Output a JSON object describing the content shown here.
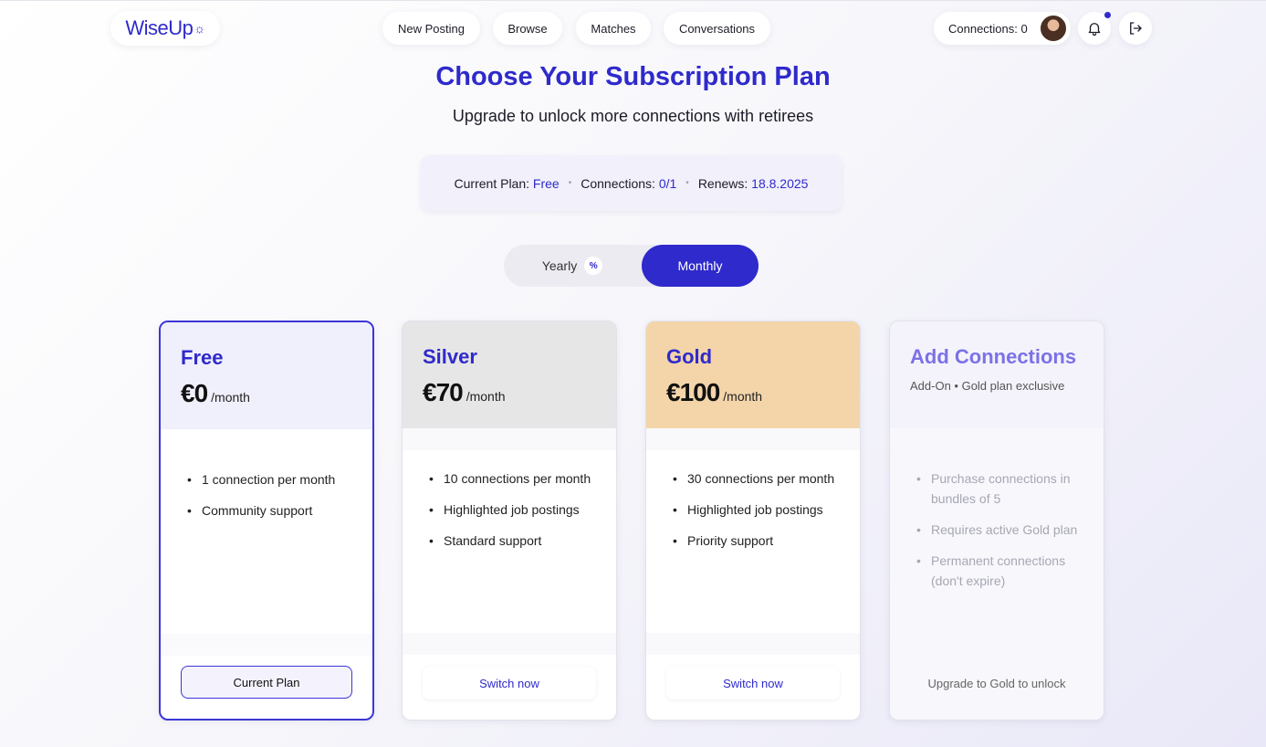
{
  "header": {
    "logo_text": "WiseUp",
    "nav": [
      "New Posting",
      "Browse",
      "Matches",
      "Conversations"
    ],
    "connections_label": "Connections: 0"
  },
  "page": {
    "title": "Choose Your Subscription Plan",
    "subtitle": "Upgrade to unlock more connections with retirees"
  },
  "status": {
    "plan_label": "Current Plan:",
    "plan_value": "Free",
    "connections_label": "Connections:",
    "connections_value": "0/1",
    "renews_label": "Renews:",
    "renews_value": "18.8.2025"
  },
  "billing_toggle": {
    "yearly_label": "Yearly",
    "yearly_badge": "%",
    "monthly_label": "Monthly",
    "selected": "Monthly"
  },
  "plans": [
    {
      "name": "Free",
      "amount": "€0",
      "per": "/month",
      "features": [
        "1 connection per month",
        "Community support"
      ],
      "button": "Current Plan",
      "header_color": "#f0effc"
    },
    {
      "name": "Silver",
      "amount": "€70",
      "per": "/month",
      "features": [
        "10 connections per month",
        "Highlighted job postings",
        "Standard support"
      ],
      "button": "Switch now",
      "header_color": "#e6e6e6"
    },
    {
      "name": "Gold",
      "amount": "€100",
      "per": "/month",
      "features": [
        "30 connections per month",
        "Highlighted job postings",
        "Priority support"
      ],
      "button": "Switch now",
      "header_color": "#f3d5a9"
    },
    {
      "name": "Add Connections",
      "tagline": "Add-On • Gold plan exclusive",
      "features": [
        "Purchase connections in bundles of 5",
        "Requires active Gold plan",
        "Permanent connections (don't expire)"
      ],
      "button": "Upgrade to Gold to unlock"
    }
  ],
  "colors": {
    "accent": "#2f2acb",
    "addon_title": "#7b72e6"
  }
}
